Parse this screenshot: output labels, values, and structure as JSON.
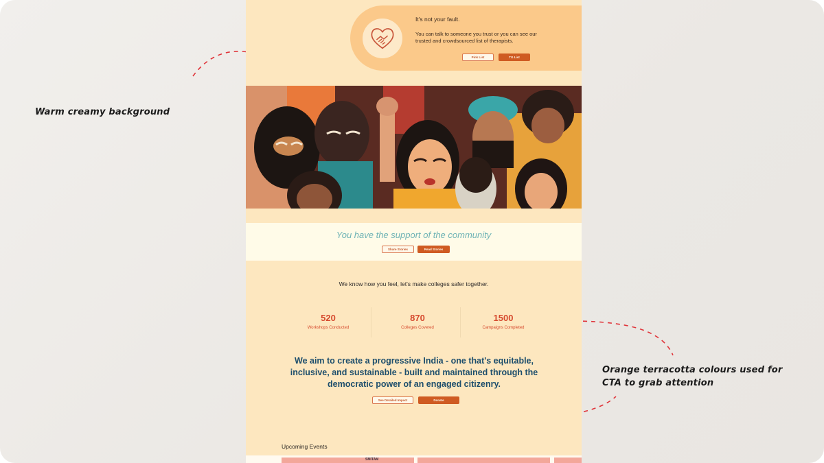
{
  "annotations": {
    "background_note": "Warm creamy background",
    "cta_note_line1": "Orange terracotta colours used for",
    "cta_note_line2": "CTA to grab attention"
  },
  "help_card": {
    "title": "It's not your fault.",
    "body": "You can talk to someone you trust or you can see our trusted and crowdsourced list of therapists.",
    "button_outline": "Pink List",
    "button_solid": "TG List"
  },
  "support": {
    "title": "You have the support of the community",
    "button_outline": "Share Stories",
    "button_solid": "Read Stories"
  },
  "tagline": "We know how you feel, let's make colleges safer together.",
  "stats": [
    {
      "value": "520",
      "label": "Workshops Conducted"
    },
    {
      "value": "870",
      "label": "Colleges Covered"
    },
    {
      "value": "1500",
      "label": "Campaigns Completed"
    }
  ],
  "mission": {
    "text": "We aim to create a progressive India - one that's equitable, inclusive, and sustainable - built and maintained through the democratic power of an engaged citizenry.",
    "button_outline": "See Detailed Impact",
    "button_solid": "Donate"
  },
  "events": {
    "title": "Upcoming Events",
    "card_text": "SMITAM"
  },
  "colors": {
    "canvas": "#ece9e5",
    "page_background": "#fde7bf",
    "card_background": "#fbc98a",
    "cta_terracotta": "#cf5b22",
    "stat_red": "#d64a2e",
    "mission_blue": "#1d4e6c",
    "support_teal": "#6fb3b5",
    "annotation_red": "#e0343a"
  }
}
